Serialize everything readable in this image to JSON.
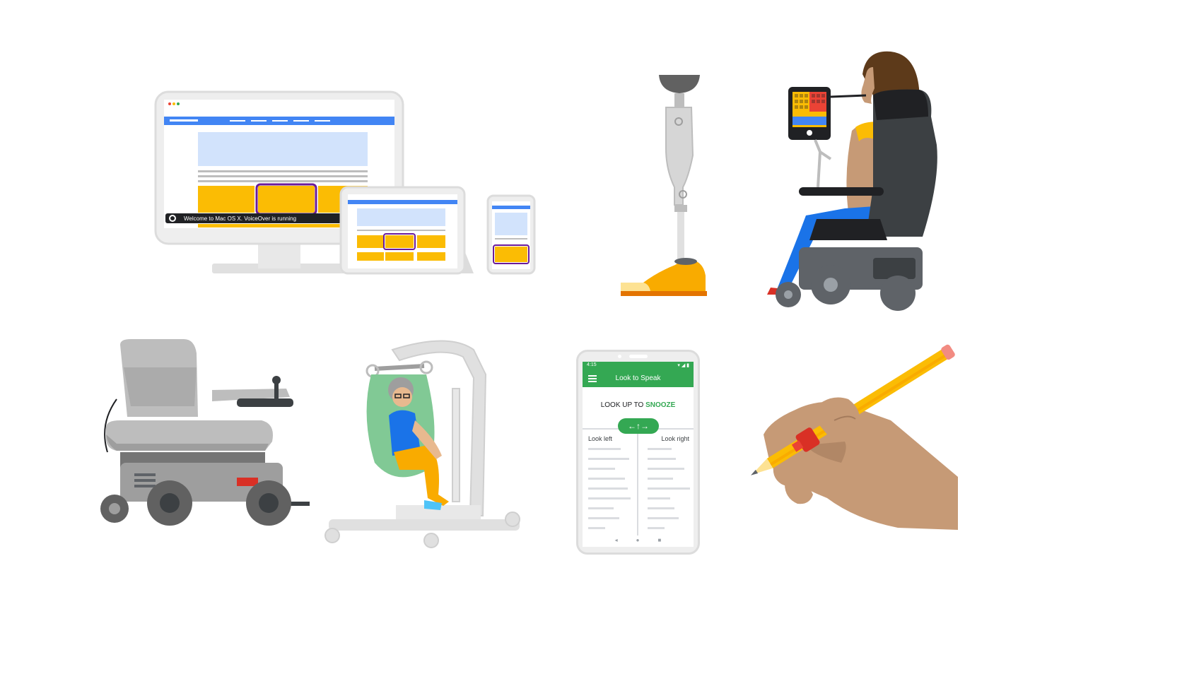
{
  "devices": {
    "voiceover_caption": "Welcome to Mac OS X. VoiceOver is running"
  },
  "look_to_speak": {
    "status_time": "4:15",
    "app_title": "Look to Speak",
    "instruction_prefix": "LOOK UP TO ",
    "instruction_action": "SNOOZE",
    "look_left_label": "Look left",
    "look_right_label": "Look right",
    "accent_color": "#34a853"
  },
  "colors": {
    "yellow": "#fbbc04",
    "blue": "#4285f4",
    "green": "#34a853",
    "red": "#ea4335",
    "skin": "#c69a76"
  }
}
